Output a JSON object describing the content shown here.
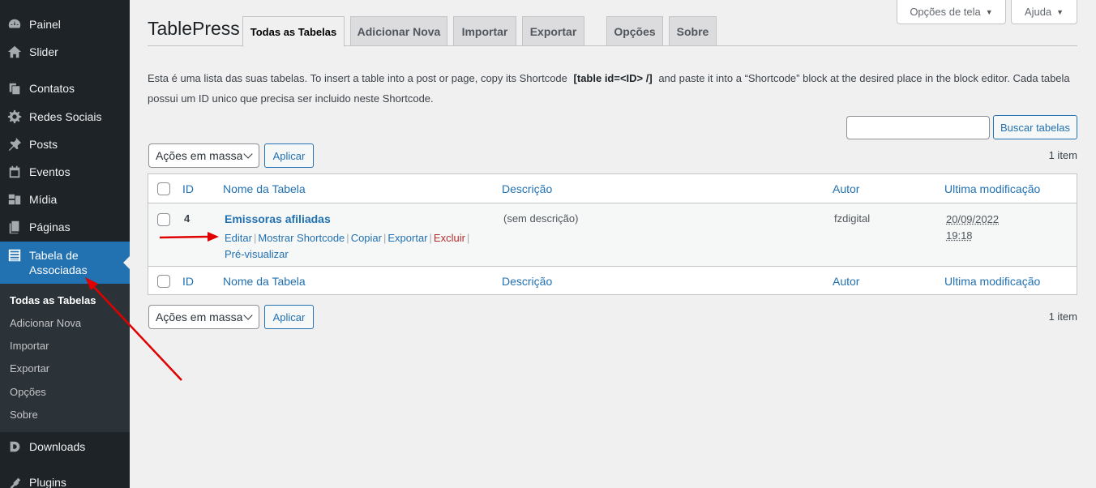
{
  "sidebar": {
    "items": [
      {
        "label": "Painel",
        "icon": "dashboard-icon"
      },
      {
        "label": "Slider",
        "icon": "home-icon"
      },
      {
        "label": "Contatos",
        "icon": "copy-icon"
      },
      {
        "label": "Redes Sociais",
        "icon": "gear-icon"
      },
      {
        "label": "Posts",
        "icon": "pin-icon"
      },
      {
        "label": "Eventos",
        "icon": "calendar-icon"
      },
      {
        "label": "Mídia",
        "icon": "media-icon"
      },
      {
        "label": "Páginas",
        "icon": "pages-icon"
      },
      {
        "label_line1": "Tabela de",
        "label_line2": "Associadas",
        "icon": "table-icon"
      },
      {
        "label": "Downloads",
        "icon": "download-d-icon"
      },
      {
        "label": "Plugins",
        "icon": "plugin-icon"
      }
    ],
    "submenu": [
      "Todas as Tabelas",
      "Adicionar Nova",
      "Importar",
      "Exportar",
      "Opções",
      "Sobre"
    ]
  },
  "screen_meta": {
    "options": "Opções de tela",
    "help": "Ajuda"
  },
  "header": {
    "brand": "TablePress",
    "tabs": [
      "Todas as Tabelas",
      "Adicionar Nova",
      "Importar",
      "Exportar",
      "Opções",
      "Sobre"
    ]
  },
  "description": {
    "part1": "Esta é uma lista das suas tabelas. To insert a table into a post or page, copy its Shortcode",
    "shortcode": "[table id=<ID> /]",
    "part2": "and paste it into a “Shortcode” block at the desired place in the block editor. Cada tabela possui um ID unico que precisa ser incluido neste Shortcode."
  },
  "search": {
    "button": "Buscar tabelas",
    "value": ""
  },
  "bulk": {
    "select": "Ações em massa",
    "apply": "Aplicar",
    "count": "1 item"
  },
  "table": {
    "columns": [
      "ID",
      "Nome da Tabela",
      "Descrição",
      "Autor",
      "Ultima modificação"
    ],
    "rows": [
      {
        "id": "4",
        "name": "Emissoras afiliadas",
        "description": "(sem descrição)",
        "author": "fzdigital",
        "date": "20/09/2022",
        "time": "19:18",
        "actions": {
          "edit": "Editar",
          "shortcode": "Mostrar Shortcode",
          "copy": "Copiar",
          "export": "Exportar",
          "delete": "Excluir",
          "preview": "Pré-visualizar"
        }
      }
    ]
  },
  "colors": {
    "accent": "#2271b1",
    "sidebar": "#1d2327",
    "danger": "#b32d2e",
    "annotation": "#e00000"
  }
}
